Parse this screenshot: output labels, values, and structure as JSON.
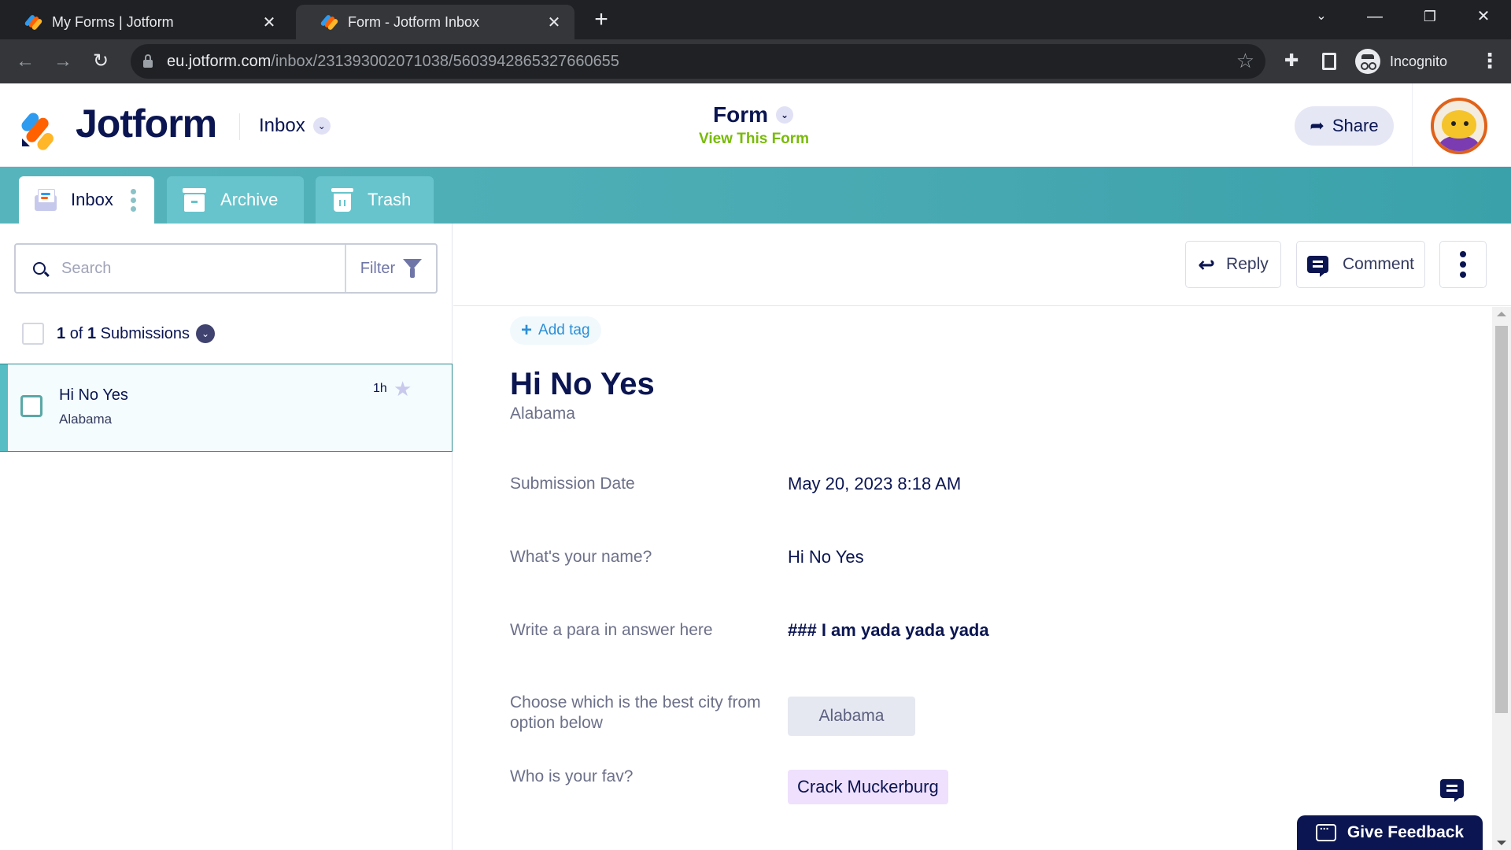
{
  "browser": {
    "tabs": [
      {
        "title": "My Forms | Jotform",
        "active": false
      },
      {
        "title": "Form - Jotform Inbox",
        "active": true
      }
    ],
    "url_domain": "eu.jotform.com",
    "url_path": "/inbox/231393002071038/5603942865327660655",
    "profile_label": "Incognito"
  },
  "header": {
    "brand": "Jotform",
    "section_dropdown": "Inbox",
    "form_title": "Form",
    "view_form_link": "View This Form",
    "share_label": "Share"
  },
  "inbox_tabs": [
    {
      "label": "Inbox",
      "active": true
    },
    {
      "label": "Archive",
      "active": false
    },
    {
      "label": "Trash",
      "active": false
    }
  ],
  "list": {
    "search_placeholder": "Search",
    "filter_label": "Filter",
    "count_current": "1",
    "count_of": "of",
    "count_total": "1",
    "count_suffix": "Submissions",
    "items": [
      {
        "name": "Hi No Yes",
        "subtitle": "Alabama",
        "time": "1h",
        "starred": false,
        "selected": true
      }
    ]
  },
  "detail": {
    "actions": {
      "reply": "Reply",
      "comment": "Comment"
    },
    "add_tag": "Add tag",
    "title": "Hi No Yes",
    "subtitle": "Alabama",
    "fields": [
      {
        "label": "Submission Date",
        "value": "May 20, 2023 8:18 AM"
      },
      {
        "label": "What's your name?",
        "value": "Hi No Yes"
      },
      {
        "label": "Write a para in answer here",
        "value": "### I am yada yada yada"
      },
      {
        "label": "Choose which is the best city from option below",
        "value": "Alabama"
      },
      {
        "label": "Who is your fav?",
        "value": "Crack Muckerburg"
      }
    ]
  },
  "feedback_label": "Give Feedback",
  "colors": {
    "brand_navy": "#0a1551",
    "teal_bar": "#48a9b2",
    "link_green": "#78bb07",
    "tag_blue": "#2b8fd6"
  }
}
